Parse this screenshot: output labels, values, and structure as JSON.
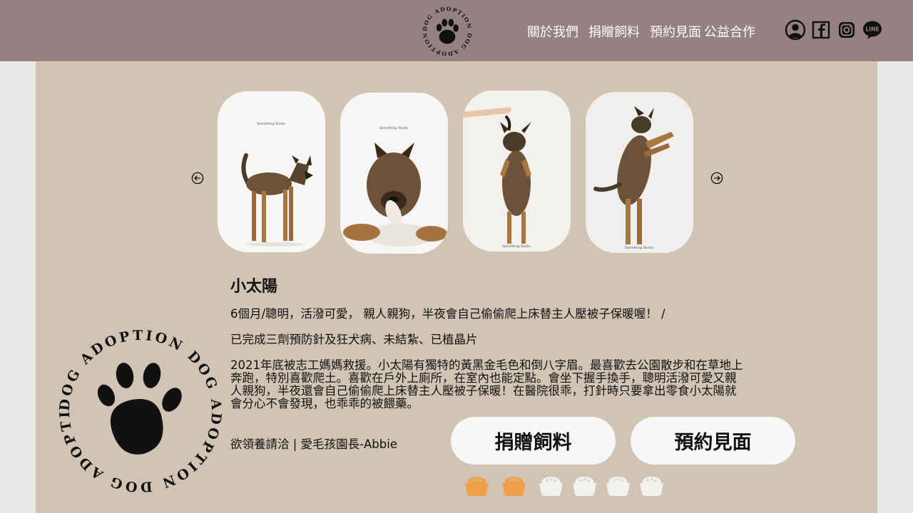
{
  "header": {
    "logo_text": "DOG ADOPTION DOG ADOPTION",
    "nav": [
      "關於我們",
      "捐贈飼料",
      "預約見面",
      "公益合作"
    ],
    "social_icons": [
      "user-icon",
      "facebook-icon",
      "instagram-icon",
      "line-icon"
    ],
    "background": "#958181"
  },
  "carousel": {
    "prev_icon": "arrow-left-circle-icon",
    "next_icon": "arrow-right-circle-icon",
    "photo_caption": "Something Studio",
    "photos": [
      "dog-standing",
      "dog-lying-with-toy",
      "dog-jumping-for-treat",
      "dog-standing-on-hind-legs"
    ]
  },
  "dog": {
    "name": "小太陽",
    "summary": "6個月/聰明，活潑可愛， 親人親狗，半夜會自己偷偷爬上床替主人壓被子保暖喔！ /",
    "medical": "已完成三劑預防針及狂犬病、未結紮、已植晶片",
    "story_lines": [
      "2021年底被志工媽媽救援。小太陽有獨特的黃黑金毛色和倒八字眉。最喜歡去公園散步和在草地上",
      "奔跑，特別喜歡爬土。喜歡在戶外上廁所，在室內也能定點。會坐下握手換手，聰明活潑可愛又親",
      "人親狗，半夜還會自己偷偷爬上床替主人壓被子保暖！在醫院很乖，打針時只要拿出零食小太陽就",
      "會分心不會發現，也乖乖的被餵藥。"
    ],
    "contact": "欲領養請洽 | 愛毛孩園長-Abbie"
  },
  "actions": {
    "donate": "捐贈飼料",
    "appointment": "預約見面"
  },
  "food_level": {
    "filled": 2,
    "total": 6,
    "filled_color": "#f0a04b",
    "empty_color": "#f2f1ee"
  },
  "footer_logo_text": "DOG ADOPTION DOG ADOPTION DOG ADOPTION"
}
